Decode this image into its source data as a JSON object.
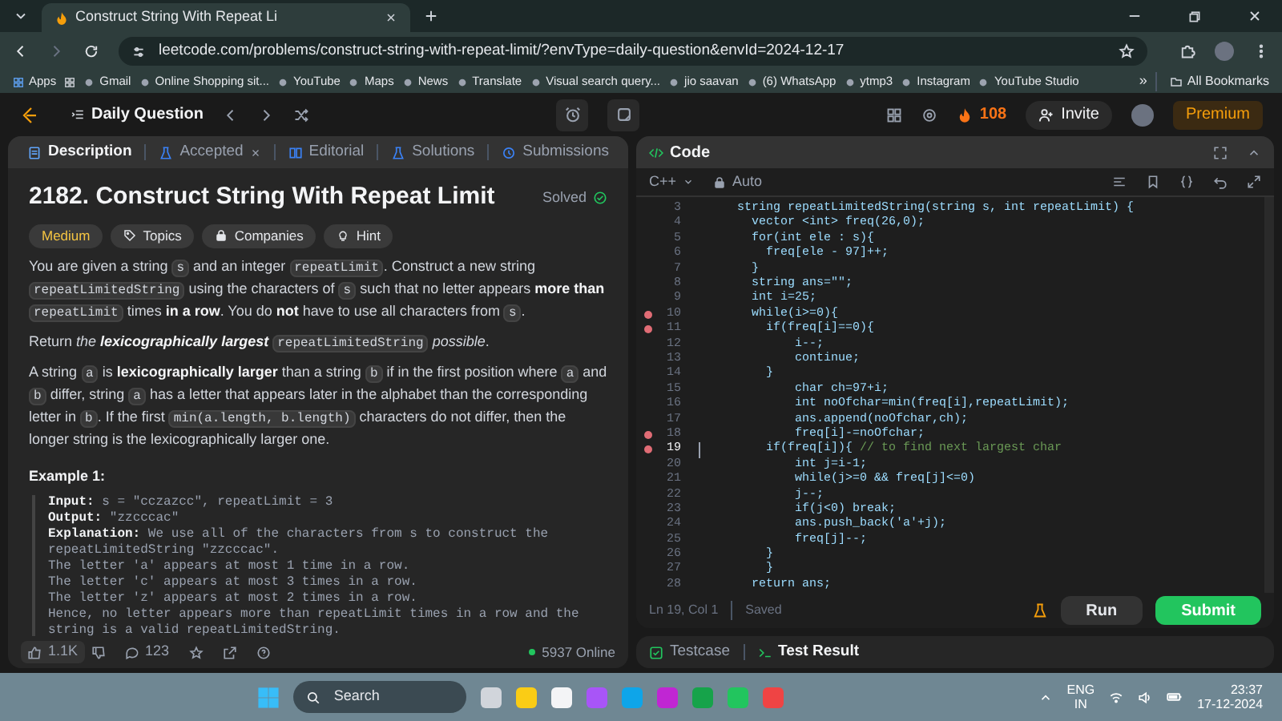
{
  "browser": {
    "tab": {
      "title": "Construct String With Repeat Li",
      "selected": true
    },
    "url": "leetcode.com/problems/construct-string-with-repeat-limit/?envType=daily-question&envId=2024-12-17",
    "bookmarks": [
      "Apps",
      "Gmail",
      "Online Shopping sit...",
      "YouTube",
      "Maps",
      "News",
      "Translate",
      "Visual search query...",
      "jio saavan",
      "(6) WhatsApp",
      "ytmp3",
      "Instagram",
      "YouTube Studio"
    ],
    "overflow": "»",
    "all_bookmarks": "All Bookmarks"
  },
  "nav": {
    "title": "Daily Question",
    "streak": "108",
    "invite": "Invite",
    "premium": "Premium"
  },
  "description": {
    "tabs": [
      {
        "label": "Description",
        "kind": "description",
        "selected": true
      },
      {
        "label": "Accepted",
        "kind": "accepted",
        "selected": false
      },
      {
        "label": "Editorial",
        "kind": "editorial",
        "selected": false
      },
      {
        "label": "Solutions",
        "kind": "solutions",
        "selected": false
      },
      {
        "label": "Submissions",
        "kind": "submissions",
        "selected": false
      }
    ],
    "title": "2182. Construct String With Repeat Limit",
    "status": "Solved",
    "tags": [
      {
        "label": "Medium",
        "kind": "difficulty"
      },
      {
        "label": "Topics",
        "kind": "topics"
      },
      {
        "label": "Companies",
        "kind": "companies"
      },
      {
        "label": "Hint",
        "kind": "hint"
      }
    ],
    "paragraphs": [
      [
        {
          "kind": "text",
          "text": "You are given a string "
        },
        {
          "kind": "code",
          "text": "s"
        },
        {
          "kind": "text",
          "text": " and an integer "
        },
        {
          "kind": "code",
          "text": "repeatLimit"
        },
        {
          "kind": "text",
          "text": ". Construct a new string "
        },
        {
          "kind": "code",
          "text": "repeatLimitedString"
        },
        {
          "kind": "text",
          "text": " using the characters of "
        },
        {
          "kind": "code",
          "text": "s"
        },
        {
          "kind": "text",
          "text": " such that no letter appears "
        },
        {
          "kind": "bold",
          "text": "more than "
        },
        {
          "kind": "code",
          "text": "repeatLimit"
        },
        {
          "kind": "text",
          "text": " times "
        },
        {
          "kind": "bold",
          "text": "in a row"
        },
        {
          "kind": "text",
          "text": ". You do "
        },
        {
          "kind": "bold",
          "text": "not"
        },
        {
          "kind": "text",
          "text": " have to use all characters from "
        },
        {
          "kind": "code",
          "text": "s"
        },
        {
          "kind": "text",
          "text": "."
        }
      ],
      [
        {
          "kind": "text",
          "text": "Return "
        },
        {
          "kind": "italic",
          "text": "the "
        },
        {
          "kind": "bold_italic",
          "text": "lexicographically largest "
        },
        {
          "kind": "code",
          "text": "repeatLimitedString"
        },
        {
          "kind": "italic",
          "text": " possible"
        },
        {
          "kind": "text",
          "text": "."
        }
      ],
      [
        {
          "kind": "text",
          "text": "A string "
        },
        {
          "kind": "code",
          "text": "a"
        },
        {
          "kind": "text",
          "text": " is "
        },
        {
          "kind": "bold",
          "text": "lexicographically larger"
        },
        {
          "kind": "text",
          "text": " than a string "
        },
        {
          "kind": "code",
          "text": "b"
        },
        {
          "kind": "text",
          "text": " if in the first position where "
        },
        {
          "kind": "code",
          "text": "a"
        },
        {
          "kind": "text",
          "text": " and "
        },
        {
          "kind": "code",
          "text": "b"
        },
        {
          "kind": "text",
          "text": " differ, string "
        },
        {
          "kind": "code",
          "text": "a"
        },
        {
          "kind": "text",
          "text": " has a letter that appears later in the alphabet than the corresponding letter in "
        },
        {
          "kind": "code",
          "text": "b"
        },
        {
          "kind": "text",
          "text": ". If the first "
        },
        {
          "kind": "code",
          "text": "min(a.length, b.length)"
        },
        {
          "kind": "text",
          "text": " characters do not differ, then the longer string is the lexicographically larger one."
        }
      ]
    ],
    "example_title": "Example 1:",
    "example": [
      {
        "label": "Input:",
        "text": " s = \"cczazcc\", repeatLimit = 3"
      },
      {
        "label": "Output:",
        "text": " \"zzcccac\""
      },
      {
        "label": "Explanation:",
        "text": " We use all of the characters from s to construct the repeatLimitedString \"zzcccac\"."
      },
      {
        "text": "The letter 'a' appears at most 1 time in a row."
      },
      {
        "text": "The letter 'c' appears at most 3 times in a row."
      },
      {
        "text": "The letter 'z' appears at most 2 times in a row."
      },
      {
        "text": "Hence, no letter appears more than repeatLimit times in a row and the string is a valid repeatLimitedString."
      }
    ],
    "likes": "1.1K",
    "comments": "123",
    "online": "5937 Online"
  },
  "editor": {
    "title": "Code",
    "language": "C++",
    "mode": "Auto",
    "lines": [
      {
        "number": "3",
        "text": "  string repeatLimitedString(string s, int repeatLimit) {",
        "breakpoint": false,
        "current": false
      },
      {
        "number": "4",
        "text": "    vector <int> freq(26,0);",
        "breakpoint": false,
        "current": false
      },
      {
        "number": "5",
        "text": "    for(int ele : s){",
        "breakpoint": false,
        "current": false
      },
      {
        "number": "6",
        "text": "      freq[ele - 97]++;",
        "breakpoint": false,
        "current": false
      },
      {
        "number": "7",
        "text": "    }",
        "breakpoint": false,
        "current": false
      },
      {
        "number": "8",
        "text": "    string ans=\"\";",
        "breakpoint": false,
        "current": false
      },
      {
        "number": "9",
        "text": "    int i=25;",
        "breakpoint": false,
        "current": false
      },
      {
        "number": "10",
        "text": "    while(i>=0){",
        "breakpoint": true,
        "current": false
      },
      {
        "number": "11",
        "text": "      if(freq[i]==0){",
        "breakpoint": true,
        "current": false
      },
      {
        "number": "12",
        "text": "          i--;",
        "breakpoint": false,
        "current": false
      },
      {
        "number": "13",
        "text": "          continue;",
        "breakpoint": false,
        "current": false
      },
      {
        "number": "14",
        "text": "      }",
        "breakpoint": false,
        "current": false
      },
      {
        "number": "15",
        "text": "          char ch=97+i;",
        "breakpoint": false,
        "current": false
      },
      {
        "number": "16",
        "text": "          int noOfchar=min(freq[i],repeatLimit);",
        "breakpoint": false,
        "current": false
      },
      {
        "number": "17",
        "text": "          ans.append(noOfchar,ch);",
        "breakpoint": false,
        "current": false
      },
      {
        "number": "18",
        "text": "          freq[i]-=noOfchar;",
        "breakpoint": true,
        "current": false
      },
      {
        "number": "19",
        "text": "      if(freq[i]){",
        "comment": " // to find next largest char",
        "breakpoint": true,
        "current": true
      },
      {
        "number": "20",
        "text": "          int j=i-1;",
        "breakpoint": false,
        "current": false
      },
      {
        "number": "21",
        "text": "          while(j>=0 && freq[j]<=0)",
        "breakpoint": false,
        "current": false
      },
      {
        "number": "22",
        "text": "          j--;",
        "breakpoint": false,
        "current": false
      },
      {
        "number": "23",
        "text": "          if(j<0) break;",
        "breakpoint": false,
        "current": false
      },
      {
        "number": "24",
        "text": "          ans.push_back('a'+j);",
        "breakpoint": false,
        "current": false
      },
      {
        "number": "25",
        "text": "          freq[j]--;",
        "breakpoint": false,
        "current": false
      },
      {
        "number": "26",
        "text": "      }",
        "breakpoint": false,
        "current": false
      },
      {
        "number": "27",
        "text": "      }",
        "breakpoint": false,
        "current": false
      },
      {
        "number": "28",
        "text": "    return ans;",
        "breakpoint": false,
        "current": false
      }
    ],
    "cursor": "Ln 19, Col 1",
    "save_state": "Saved",
    "run": "Run",
    "submit": "Submit"
  },
  "bottom_tabs": [
    {
      "label": "Testcase",
      "selected": false
    },
    {
      "label": "Test Result",
      "selected": true
    }
  ],
  "taskbar": {
    "search": "Search",
    "language": "ENG",
    "region": "IN",
    "time": "23:37",
    "date": "17-12-2024"
  }
}
